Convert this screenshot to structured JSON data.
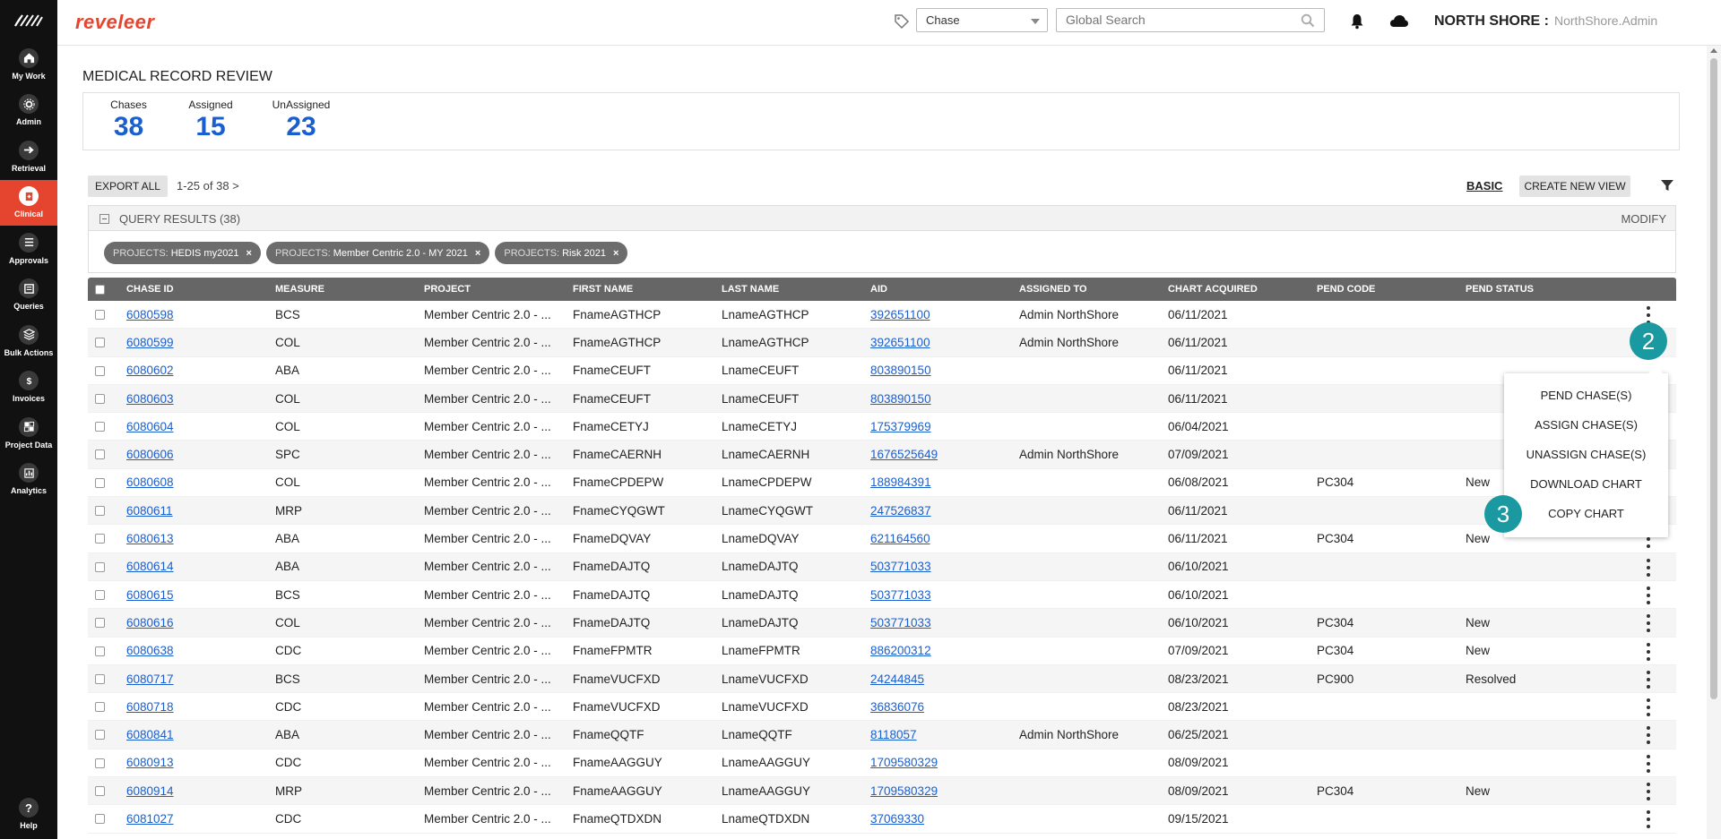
{
  "app": {
    "brand": "reveleer"
  },
  "sidebar": {
    "items": [
      {
        "label": "My Work",
        "icon": "home-icon"
      },
      {
        "label": "Admin",
        "icon": "admin-icon"
      },
      {
        "label": "Retrieval",
        "icon": "retrieval-icon"
      },
      {
        "label": "Clinical",
        "icon": "clinical-icon",
        "active": true
      },
      {
        "label": "Approvals",
        "icon": "approvals-icon"
      },
      {
        "label": "Queries",
        "icon": "queries-icon"
      },
      {
        "label": "Bulk Actions",
        "icon": "bulk-actions-icon"
      },
      {
        "label": "Invoices",
        "icon": "invoices-icon"
      },
      {
        "label": "Project Data",
        "icon": "project-data-icon"
      },
      {
        "label": "Analytics",
        "icon": "analytics-icon"
      }
    ],
    "help_label": "Help"
  },
  "header": {
    "type_select_value": "Chase",
    "search_placeholder": "Global Search",
    "org_name": "NORTH SHORE :",
    "user_name": "NorthShore.Admin"
  },
  "page": {
    "title": "MEDICAL RECORD REVIEW",
    "stats": [
      {
        "label": "Chases",
        "value": "38"
      },
      {
        "label": "Assigned",
        "value": "15"
      },
      {
        "label": "UnAssigned",
        "value": "23"
      }
    ]
  },
  "toolbar": {
    "export_label": "EXPORT ALL",
    "pager_text": "1-25  of  38 >",
    "basic_label": "BASIC",
    "create_view_label": "CREATE NEW VIEW"
  },
  "query": {
    "title": "QUERY RESULTS (38)",
    "modify_label": "MODIFY",
    "chips": [
      {
        "key": "PROJECTS:",
        "value": "HEDIS my2021"
      },
      {
        "key": "PROJECTS:",
        "value": "Member Centric 2.0 - MY 2021"
      },
      {
        "key": "PROJECTS:",
        "value": "Risk 2021"
      }
    ],
    "chip_remove_glyph": "×"
  },
  "table": {
    "columns": [
      "CHASE ID",
      "MEASURE",
      "PROJECT",
      "FIRST NAME",
      "LAST NAME",
      "AID",
      "ASSIGNED TO",
      "CHART ACQUIRED",
      "PEND CODE",
      "PEND STATUS"
    ],
    "rows": [
      [
        "6080598",
        "BCS",
        "Member Centric 2.0 - ...",
        "FnameAGTHCP",
        "LnameAGTHCP",
        "392651100",
        "Admin NorthShore",
        "06/11/2021",
        "",
        ""
      ],
      [
        "6080599",
        "COL",
        "Member Centric 2.0 - ...",
        "FnameAGTHCP",
        "LnameAGTHCP",
        "392651100",
        "Admin NorthShore",
        "06/11/2021",
        "",
        ""
      ],
      [
        "6080602",
        "ABA",
        "Member Centric 2.0 - ...",
        "FnameCEUFT",
        "LnameCEUFT",
        "803890150",
        "",
        "06/11/2021",
        "",
        ""
      ],
      [
        "6080603",
        "COL",
        "Member Centric 2.0 - ...",
        "FnameCEUFT",
        "LnameCEUFT",
        "803890150",
        "",
        "06/11/2021",
        "",
        ""
      ],
      [
        "6080604",
        "COL",
        "Member Centric 2.0 - ...",
        "FnameCETYJ",
        "LnameCETYJ",
        "175379969",
        "",
        "06/04/2021",
        "",
        ""
      ],
      [
        "6080606",
        "SPC",
        "Member Centric 2.0 - ...",
        "FnameCAERNH",
        "LnameCAERNH",
        "1676525649",
        "Admin NorthShore",
        "07/09/2021",
        "",
        ""
      ],
      [
        "6080608",
        "COL",
        "Member Centric 2.0 - ...",
        "FnameCPDEPW",
        "LnameCPDEPW",
        "188984391",
        "",
        "06/08/2021",
        "PC304",
        "New"
      ],
      [
        "6080611",
        "MRP",
        "Member Centric 2.0 - ...",
        "FnameCYQGWT",
        "LnameCYQGWT",
        "247526837",
        "",
        "06/11/2021",
        "",
        ""
      ],
      [
        "6080613",
        "ABA",
        "Member Centric 2.0 - ...",
        "FnameDQVAY",
        "LnameDQVAY",
        "621164560",
        "",
        "06/11/2021",
        "PC304",
        "New"
      ],
      [
        "6080614",
        "ABA",
        "Member Centric 2.0 - ...",
        "FnameDAJTQ",
        "LnameDAJTQ",
        "503771033",
        "",
        "06/10/2021",
        "",
        ""
      ],
      [
        "6080615",
        "BCS",
        "Member Centric 2.0 - ...",
        "FnameDAJTQ",
        "LnameDAJTQ",
        "503771033",
        "",
        "06/10/2021",
        "",
        ""
      ],
      [
        "6080616",
        "COL",
        "Member Centric 2.0 - ...",
        "FnameDAJTQ",
        "LnameDAJTQ",
        "503771033",
        "",
        "06/10/2021",
        "PC304",
        "New"
      ],
      [
        "6080638",
        "CDC",
        "Member Centric 2.0 - ...",
        "FnameFPMTR",
        "LnameFPMTR",
        "886200312",
        "",
        "07/09/2021",
        "PC304",
        "New"
      ],
      [
        "6080717",
        "BCS",
        "Member Centric 2.0 - ...",
        "FnameVUCFXD",
        "LnameVUCFXD",
        "24244845",
        "",
        "08/23/2021",
        "PC900",
        "Resolved"
      ],
      [
        "6080718",
        "CDC",
        "Member Centric 2.0 - ...",
        "FnameVUCFXD",
        "LnameVUCFXD",
        "36836076",
        "",
        "08/23/2021",
        "",
        ""
      ],
      [
        "6080841",
        "ABA",
        "Member Centric 2.0 - ...",
        "FnameQQTF",
        "LnameQQTF",
        "8118057",
        "Admin NorthShore",
        "06/25/2021",
        "",
        ""
      ],
      [
        "6080913",
        "CDC",
        "Member Centric 2.0 - ...",
        "FnameAAGGUY",
        "LnameAAGGUY",
        "1709580329",
        "",
        "08/09/2021",
        "",
        ""
      ],
      [
        "6080914",
        "MRP",
        "Member Centric 2.0 - ...",
        "FnameAAGGUY",
        "LnameAAGGUY",
        "1709580329",
        "",
        "08/09/2021",
        "PC304",
        "New"
      ],
      [
        "6081027",
        "CDC",
        "Member Centric 2.0 - ...",
        "FnameQTDXDN",
        "LnameQTDXDN",
        "37069330",
        "",
        "09/15/2021",
        "",
        ""
      ]
    ]
  },
  "context_menu": {
    "items": [
      "PEND CHASE(S)",
      "ASSIGN CHASE(S)",
      "UNASSIGN CHASE(S)",
      "DOWNLOAD CHART",
      "COPY CHART"
    ]
  },
  "step_badges": [
    "2",
    "3"
  ],
  "colors": {
    "brand": "#e5452e",
    "link": "#1a5fcf",
    "stat_number": "#1a5fcf",
    "badge": "#1a9aa0",
    "table_header": "#666666"
  }
}
